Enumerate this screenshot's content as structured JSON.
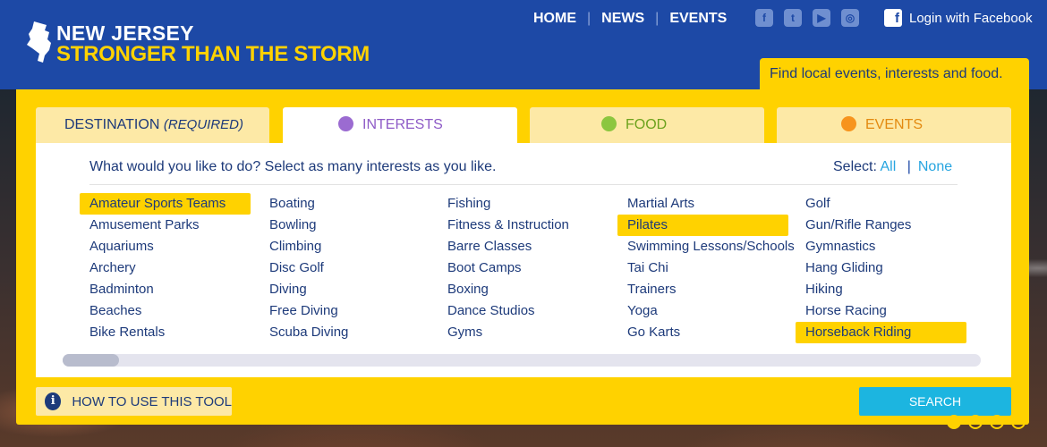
{
  "brand": {
    "line1": "NEW JERSEY",
    "line2": "STRONGER THAN THE STORM"
  },
  "nav": [
    {
      "label": "HOME"
    },
    {
      "label": "NEWS"
    },
    {
      "label": "EVENTS"
    }
  ],
  "social_icons": [
    "facebook-icon",
    "twitter-icon",
    "youtube-icon",
    "instagram-icon"
  ],
  "login": {
    "label": "Login with Facebook"
  },
  "find_banner": "Find local events, interests and food.",
  "tabs": {
    "destination": {
      "label": "DESTINATION",
      "qualifier": "(REQUIRED)"
    },
    "interests": {
      "label": "INTERESTS",
      "color": "#9b6bd1"
    },
    "food": {
      "label": "FOOD",
      "color": "#8cc63f"
    },
    "events": {
      "label": "EVENTS",
      "color": "#f7941d"
    }
  },
  "interests": {
    "prompt": "What would you like to do? Select as many interests as you like.",
    "select_label": "Select:",
    "select_all": "All",
    "select_none": "None",
    "columns": [
      [
        {
          "label": "Amateur Sports Teams",
          "selected": true
        },
        {
          "label": "Amusement Parks",
          "selected": false
        },
        {
          "label": "Aquariums",
          "selected": false
        },
        {
          "label": "Archery",
          "selected": false
        },
        {
          "label": "Badminton",
          "selected": false
        },
        {
          "label": "Beaches",
          "selected": false
        },
        {
          "label": "Bike Rentals",
          "selected": false
        }
      ],
      [
        {
          "label": "Boating",
          "selected": false
        },
        {
          "label": "Bowling",
          "selected": false
        },
        {
          "label": "Climbing",
          "selected": false
        },
        {
          "label": "Disc Golf",
          "selected": false
        },
        {
          "label": "Diving",
          "selected": false
        },
        {
          "label": "Free Diving",
          "selected": false
        },
        {
          "label": "Scuba Diving",
          "selected": false
        }
      ],
      [
        {
          "label": "Fishing",
          "selected": false
        },
        {
          "label": "Fitness & Instruction",
          "selected": false
        },
        {
          "label": "Barre Classes",
          "selected": false
        },
        {
          "label": "Boot Camps",
          "selected": false
        },
        {
          "label": "Boxing",
          "selected": false
        },
        {
          "label": "Dance Studios",
          "selected": false
        },
        {
          "label": "Gyms",
          "selected": false
        }
      ],
      [
        {
          "label": "Martial Arts",
          "selected": false
        },
        {
          "label": "Pilates",
          "selected": true
        },
        {
          "label": "Swimming Lessons/Schools",
          "selected": false
        },
        {
          "label": "Tai Chi",
          "selected": false
        },
        {
          "label": "Trainers",
          "selected": false
        },
        {
          "label": "Yoga",
          "selected": false
        },
        {
          "label": "Go Karts",
          "selected": false
        }
      ],
      [
        {
          "label": "Golf",
          "selected": false
        },
        {
          "label": "Gun/Rifle Ranges",
          "selected": false
        },
        {
          "label": "Gymnastics",
          "selected": false
        },
        {
          "label": "Hang Gliding",
          "selected": false
        },
        {
          "label": "Hiking",
          "selected": false
        },
        {
          "label": "Horse Racing",
          "selected": false
        },
        {
          "label": "Horseback Riding",
          "selected": true
        }
      ]
    ]
  },
  "howto": {
    "label": "HOW TO USE THIS TOOL",
    "icon": "info-icon"
  },
  "search": {
    "label": "SEARCH"
  },
  "slides": {
    "count": 4,
    "active": 0
  },
  "colors": {
    "header_blue": "#1d49a6",
    "accent_yellow": "#ffd200",
    "search_cyan": "#1cb5e0",
    "text_navy": "#1d3a7a"
  }
}
